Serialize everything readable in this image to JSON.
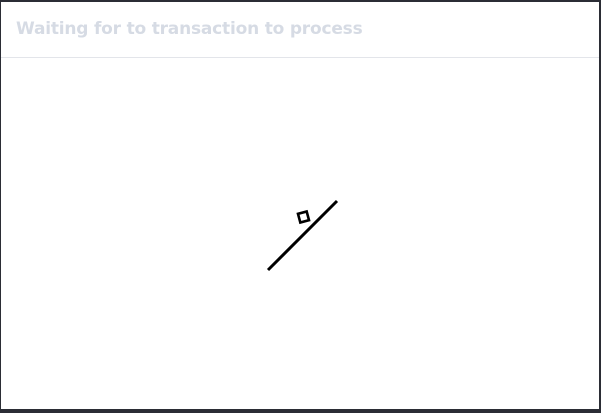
{
  "dialog": {
    "title": "Waiting for to transaction to process",
    "loader_icon": "ramp-with-square-loader-icon"
  }
}
